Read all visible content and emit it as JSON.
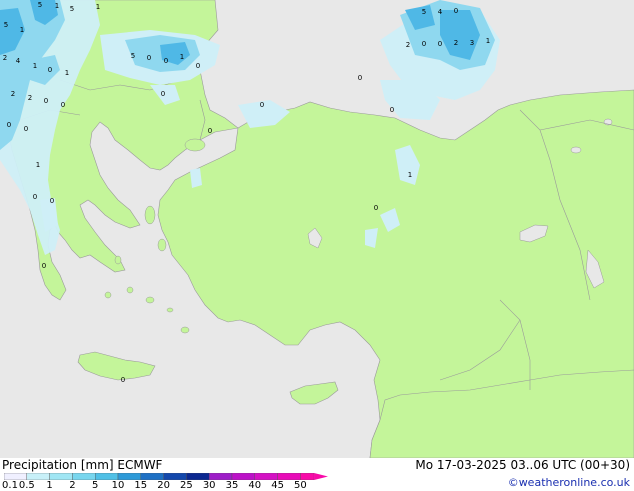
{
  "map": {
    "colors": {
      "sea": "#e8e8e8",
      "land": "#c4f59a",
      "coast": "#9a9a9a",
      "precip_light": "#cfeff7",
      "precip_mid": "#8fd8ef",
      "precip_high": "#4fb8e6",
      "label": "#000000"
    },
    "value_labels": [
      "5",
      "1",
      "5",
      "1",
      "5",
      "1",
      "2",
      "4",
      "1",
      "0",
      "1",
      "2",
      "2",
      "0",
      "0",
      "0",
      "0",
      "1",
      "0",
      "0",
      "5",
      "0",
      "0",
      "1",
      "0",
      "0",
      "0",
      "0",
      "0",
      "5",
      "4",
      "0",
      "2",
      "0",
      "0",
      "2",
      "3",
      "1",
      "0",
      "0",
      "1",
      "0",
      "0"
    ]
  },
  "legend": {
    "title": "Precipitation [mm]  ECMWF",
    "datetime": "Mo 17-03-2025 03..06 UTC (00+30)",
    "credit": "©weatheronline.co.uk",
    "ticks": [
      "0.1",
      "0.5",
      "1",
      "2",
      "5",
      "10",
      "15",
      "20",
      "25",
      "30",
      "35",
      "40",
      "45",
      "50"
    ],
    "colors": [
      "#f0f0ff",
      "#c8f0f8",
      "#a0e6f4",
      "#78d6ee",
      "#50c0e6",
      "#2e9ad8",
      "#1e70c4",
      "#1448ac",
      "#0c2890",
      "#9e1ec8",
      "#bc12c8",
      "#d412c4",
      "#e80cb8",
      "#f80aa8"
    ]
  }
}
